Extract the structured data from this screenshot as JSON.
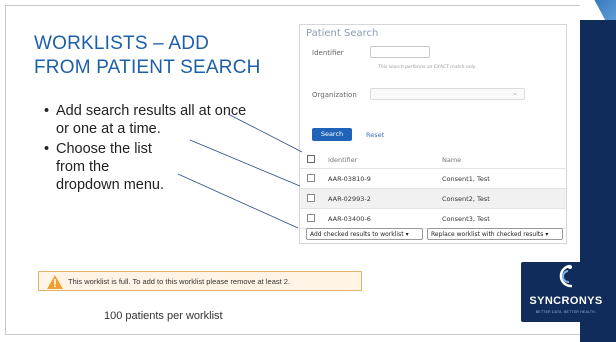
{
  "slide": {
    "title_lines": [
      "WORKLISTS – ADD",
      "FROM PATIENT SEARCH"
    ],
    "bullets": [
      {
        "lines": [
          "Add search results all at once",
          "or one at a time."
        ]
      },
      {
        "lines": [
          "Choose the list",
          "from the",
          "dropdown menu."
        ]
      }
    ],
    "caption": "100 patients per worklist"
  },
  "patient_search": {
    "title": "Patient Search",
    "identifier_label": "Identifier",
    "identifier_value": "",
    "identifier_hint": "This search performs an EXACT match only.",
    "organization_label": "Organization",
    "organization_value": "",
    "search_button": "Search",
    "reset_link": "Reset",
    "columns": [
      "Identifier",
      "Name"
    ],
    "rows": [
      {
        "identifier": "AAR-03810-9",
        "name": "Consent1, Test",
        "checked": false
      },
      {
        "identifier": "AAR-02993-2",
        "name": "Consent2, Test",
        "checked": false
      },
      {
        "identifier": "AAR-03400-6",
        "name": "Consent3, Test",
        "checked": false
      }
    ],
    "add_select": "Add checked results to worklist",
    "replace_select": "Replace worklist with checked results"
  },
  "warning": {
    "text": "This worklist is full. To add to this worklist please remove at least 2.",
    "icon": "warning-triangle-icon",
    "color": "#f0a030"
  },
  "brand": {
    "name": "SYNCRONYS",
    "tagline": "BETTER DATA. BETTER HEALTH.",
    "band_color": "#0f2c5a",
    "accent": "#1d5fa8"
  }
}
